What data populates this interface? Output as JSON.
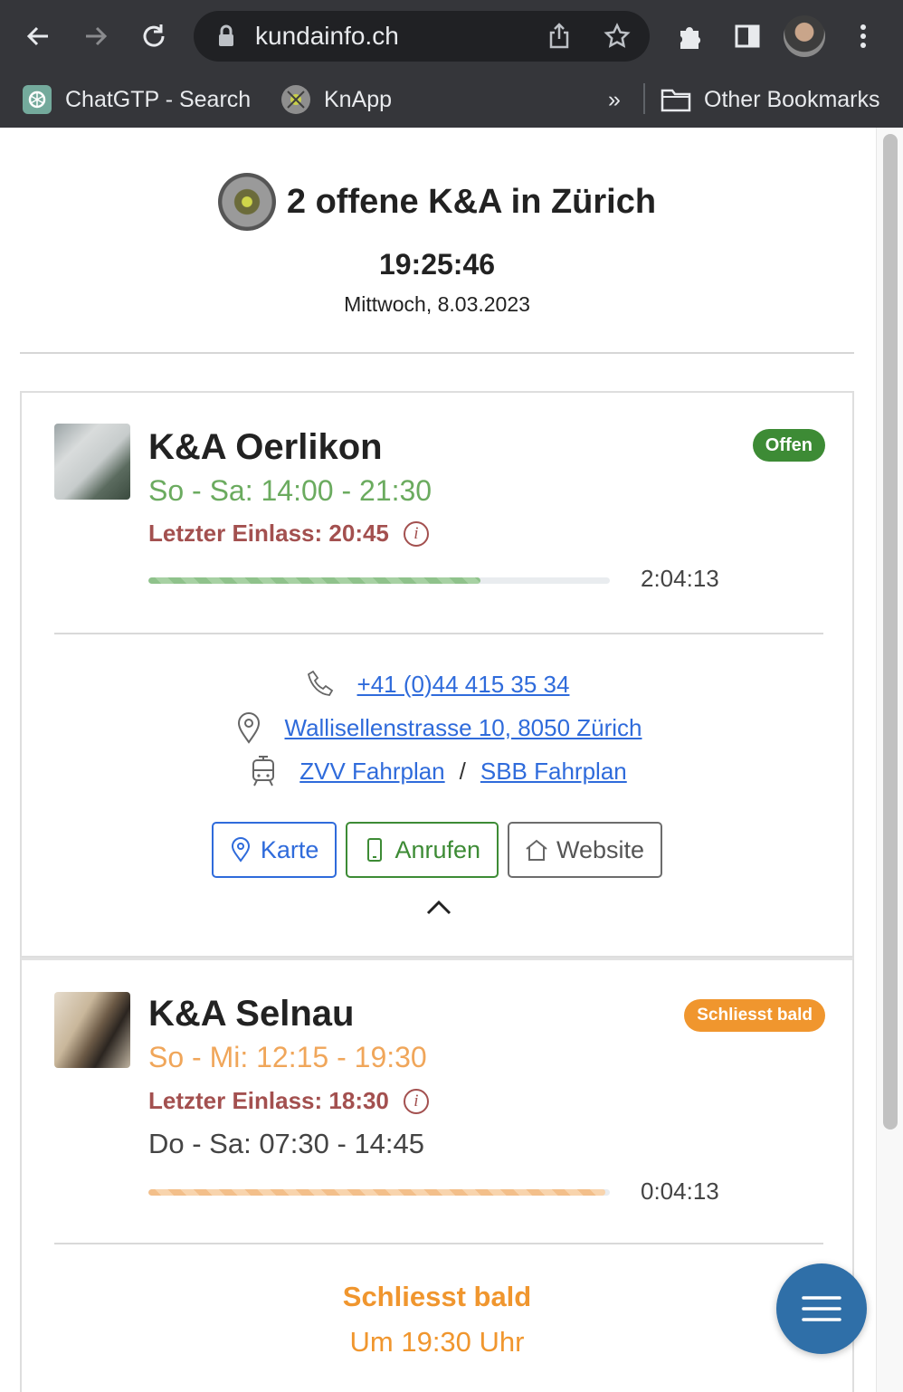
{
  "browser": {
    "url": "kundainfo.ch",
    "bookmarks": [
      {
        "label": "ChatGTP - Search",
        "icon": "openai-icon"
      },
      {
        "label": "KnApp",
        "icon": "knapp-favicon"
      }
    ],
    "overflow_label": "»",
    "other_bookmarks_label": "Other Bookmarks"
  },
  "header": {
    "title": "2 offene K&A in Zürich",
    "time": "19:25:46",
    "date": "Mittwoch, 8.03.2023"
  },
  "locations": [
    {
      "name": "K&A Oerlikon",
      "badge": "Offen",
      "hours": "So - Sa: 14:00 - 21:30",
      "hours_color": "#6bab5f",
      "last_entry": "Letzter Einlass: 20:45",
      "progress": 0.72,
      "countdown": "2:04:13",
      "phone": "+41 (0)44 415 35 34",
      "address": "Wallisellenstrasse 10, 8050 Zürich",
      "zvv_label": "ZVV Fahrplan",
      "slash": "/",
      "sbb_label": "SBB Fahrplan",
      "buttons": {
        "map": "Karte",
        "call": "Anrufen",
        "website": "Website"
      }
    },
    {
      "name": "K&A Selnau",
      "badge": "Schliesst bald",
      "hours": "So - Mi: 12:15 - 19:30",
      "hours_color": "#f0a65a",
      "last_entry": "Letzter Einlass: 18:30",
      "extra_hours": "Do - Sa: 07:30 - 14:45",
      "progress": 0.99,
      "countdown": "0:04:13",
      "closing_title": "Schliesst bald",
      "closing_sub": "Um 19:30 Uhr"
    }
  ],
  "colors": {
    "open": "#3d8b35",
    "closing_soon": "#f0962e",
    "last_entry": "#a3504f",
    "link": "#2f6bdb",
    "fab": "#2f6fa8"
  }
}
